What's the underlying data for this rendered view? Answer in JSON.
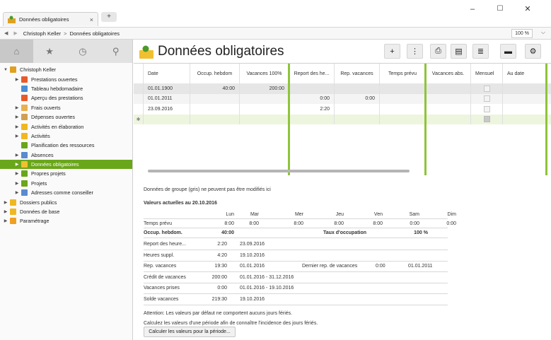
{
  "window": {
    "tab_label": "Données obligatoires",
    "tab_close": "×",
    "newtab": "+",
    "minimize": "–",
    "maximize": "☐",
    "close": "✕"
  },
  "breadcrumb": {
    "back": "◀",
    "forward": "▶",
    "items": [
      "Christoph Keller",
      "Données obligatoires"
    ],
    "separator": ">",
    "zoom": "100 %",
    "zoom_dd": "⌵"
  },
  "sidebar": {
    "tabs": [
      "⌂",
      "★",
      "◷",
      "⚲"
    ],
    "items": [
      {
        "label": "Christoph Keller",
        "arrow": "▼",
        "color": "#e0a020",
        "indent": 0
      },
      {
        "label": "Prestations ouvertes",
        "arrow": "▶",
        "color": "#e85a2a",
        "indent": 1
      },
      {
        "label": "Tableau hebdomadaire",
        "arrow": "",
        "color": "#4a8fd6",
        "indent": 1
      },
      {
        "label": "Aperçu des prestations",
        "arrow": "",
        "color": "#e85a2a",
        "indent": 1
      },
      {
        "label": "Frais ouverts",
        "arrow": "▶",
        "color": "#e8b050",
        "indent": 1
      },
      {
        "label": "Dépenses ouvertes",
        "arrow": "▶",
        "color": "#d0a050",
        "indent": 1
      },
      {
        "label": "Activités en élaboration",
        "arrow": "▶",
        "color": "#f0b820",
        "indent": 1
      },
      {
        "label": "Activités",
        "arrow": "▶",
        "color": "#f0b820",
        "indent": 1
      },
      {
        "label": "Planification des ressources",
        "arrow": "",
        "color": "#6aa61a",
        "indent": 1
      },
      {
        "label": "Absences",
        "arrow": "▶",
        "color": "#5a8ad0",
        "indent": 1
      },
      {
        "label": "Données obligatoires",
        "arrow": "▶",
        "color": "#f0c030",
        "indent": 1,
        "selected": true
      },
      {
        "label": "Propres projets",
        "arrow": "▶",
        "color": "#6aa61a",
        "indent": 1
      },
      {
        "label": "Projets",
        "arrow": "▶",
        "color": "#6aa61a",
        "indent": 1
      },
      {
        "label": "Adresses comme conseiller",
        "arrow": "▶",
        "color": "#5a8ad0",
        "indent": 1
      },
      {
        "label": "Dossiers publics",
        "arrow": "▶",
        "color": "#f0b820",
        "indent": 0
      },
      {
        "label": "Données de base",
        "arrow": "▶",
        "color": "#f0b820",
        "indent": 0
      },
      {
        "label": "Paramétrage",
        "arrow": "▶",
        "color": "#f0a020",
        "indent": 0
      }
    ]
  },
  "main": {
    "title": "Données obligatoires",
    "toolbar": [
      "+",
      "⋮",
      "⎙",
      "▤",
      "≣",
      "▬",
      "⚙"
    ],
    "columns": [
      "Date",
      "Occup. hebdom",
      "Vacances 100%",
      "Report des he...",
      "Rep. vacances",
      "Temps prévu",
      "Vacances abs.",
      "Mensuel",
      "Au date"
    ],
    "rows": [
      [
        "01.01.1900",
        "40:00",
        "200:00",
        "",
        "",
        "",
        "",
        "chk",
        ""
      ],
      [
        "01.01.2011",
        "",
        "",
        "0:00",
        "0:00",
        "",
        "",
        "chk",
        ""
      ],
      [
        "23.09.2016",
        "",
        "",
        "2:20",
        "",
        "",
        "",
        "chk",
        ""
      ],
      [
        "",
        "",
        "",
        "",
        "",
        "",
        "",
        "chk",
        ""
      ]
    ],
    "new_row_marker": "✱",
    "group_note": "Données de groupe (gris) ne peuvent pas être modifiés ici",
    "current_title": "Valeurs actuelles au 20.10.2016",
    "days": [
      "Lun",
      "Mar",
      "Mer",
      "Jeu",
      "Ven",
      "Sam",
      "Dim"
    ],
    "temps_prevu_label": "Temps prévu",
    "temps_prevu": [
      "8:00",
      "8:00",
      "8:00",
      "8:00",
      "8:00",
      "0:00",
      "0:00"
    ],
    "occup_label": "Occup. hebdom.",
    "occup_value": "40:00",
    "taux_label": "Taux d'occupation",
    "taux_value": "100 %",
    "details": [
      {
        "label": "Report des heure...",
        "value": "2:20",
        "date": "23.09.2016"
      },
      {
        "label": "Heures suppl.",
        "value": "4:20",
        "date": "19.10.2016"
      },
      {
        "label": "Rep. vacances",
        "value": "19:30",
        "date": "01.01.2016"
      },
      {
        "label": "Crédit de vacances",
        "value": "200:00",
        "date": "01.01.2016 - 31.12.2016"
      },
      {
        "label": "Vacances prises",
        "value": "0:00",
        "date": "01.01.2016 - 19.10.2016"
      },
      {
        "label": "Solde vacances",
        "value": "219:30",
        "date": "19.10.2016"
      }
    ],
    "dernier_label": "Dernier rep. de vacances",
    "dernier_value": "0:00",
    "dernier_date": "01.01.2011",
    "attention": "Attention: Les valeurs par défaut ne comportent aucuns jours fériés.",
    "calculez": "Calculez les valeurs d'une période afin de connaître l'incidence des jours fériés.",
    "calc_button": "Calculer les valeurs pour la période..."
  },
  "colors": {
    "accent": "#6aa61a",
    "column_divider": "#8fc43a",
    "gray_row": "#e6e6e6",
    "new_row": "#eef5df"
  }
}
